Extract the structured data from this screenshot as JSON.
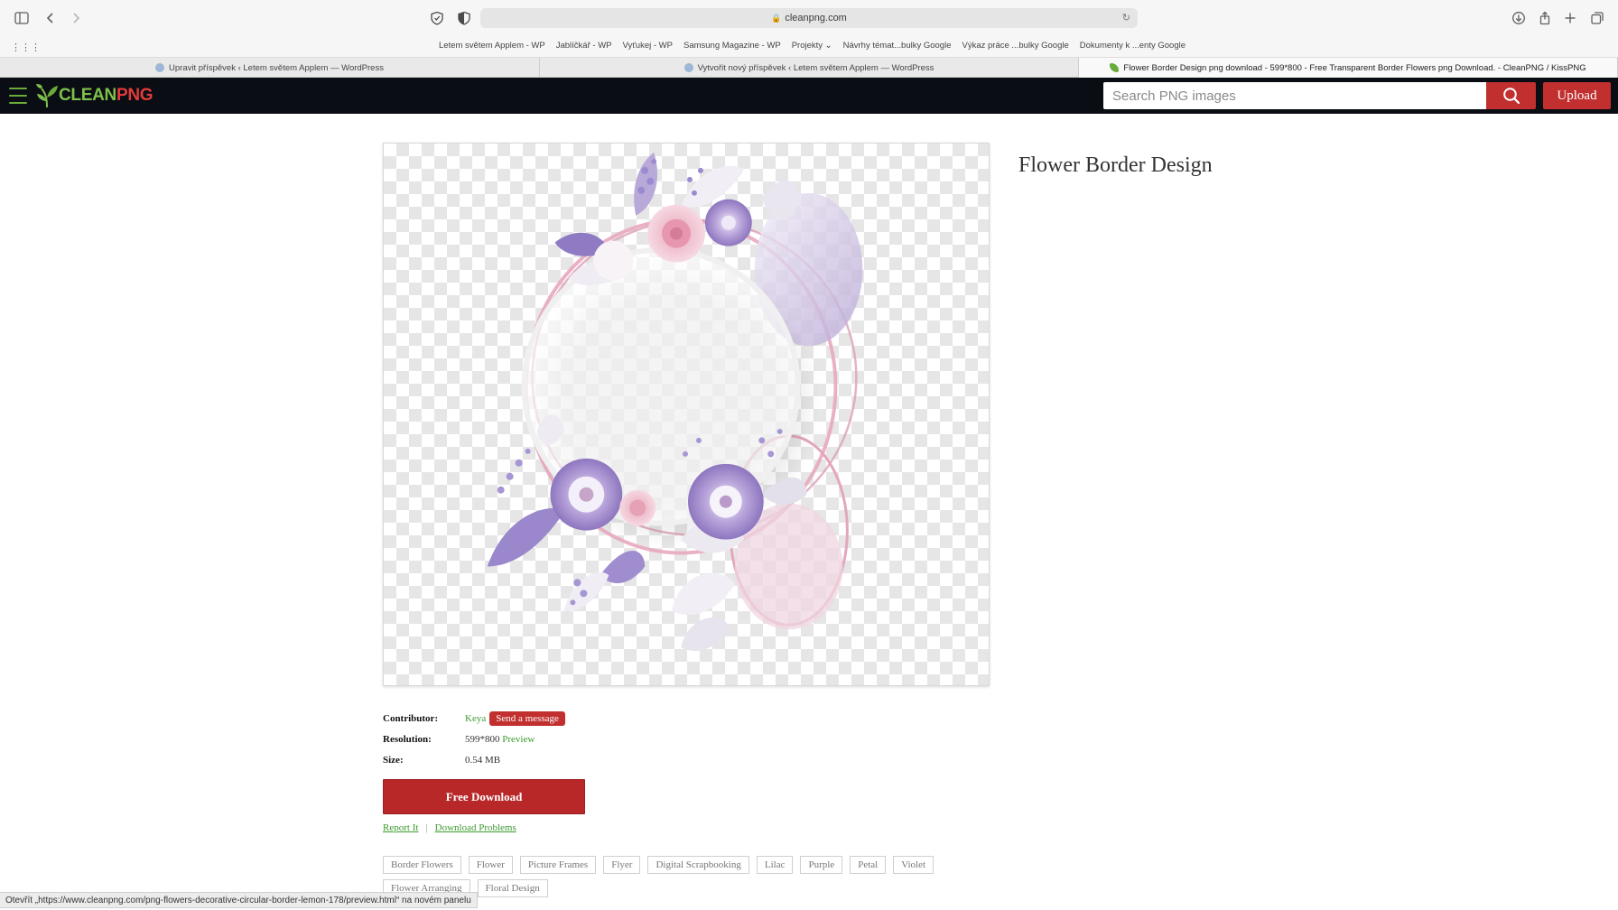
{
  "browser": {
    "url": "cleanpng.com",
    "bookmarks": [
      "Letem světem Applem - WP",
      "Jablíčkář - WP",
      "Vyťukej - WP",
      "Samsung Magazine - WP",
      "Projekty ⌄",
      "Návrhy témat...bulky Google",
      "Výkaz práce ...bulky Google",
      "Dokumenty k ...enty Google"
    ],
    "tabs": [
      {
        "label": "Upravit příspěvek ‹ Letem světem Applem — WordPress",
        "active": false
      },
      {
        "label": "Vytvořit nový příspěvek ‹ Letem světem Applem — WordPress",
        "active": false
      },
      {
        "label": "Flower Border Design png download - 599*800 - Free Transparent Border Flowers png Download. - CleanPNG / KissPNG",
        "active": true
      }
    ],
    "status_text": "Otevřít „https://www.cleanpng.com/png-flowers-decorative-circular-border-lemon-178/preview.html“ na novém panelu"
  },
  "site": {
    "logo_clean": "CLEAN",
    "logo_png": "PNG",
    "search_placeholder": "Search PNG images",
    "upload_label": "Upload"
  },
  "product": {
    "title": "Flower Border Design",
    "contributor_label": "Contributor:",
    "contributor_name": "Keya",
    "send_message": "Send a message",
    "resolution_label": "Resolution:",
    "resolution_value": "599*800",
    "preview_link": "Preview",
    "size_label": "Size:",
    "size_value": "0.54 MB",
    "download_label": "Free Download",
    "report_link": "Report It",
    "separator": "|",
    "problems_link": "Download Problems",
    "tags": [
      "Border Flowers",
      "Flower",
      "Picture Frames",
      "Flyer",
      "Digital Scrapbooking",
      "Lilac",
      "Purple",
      "Petal",
      "Violet",
      "Flower Arranging",
      "Floral Design"
    ]
  },
  "colors": {
    "header_bg": "#0a0d14",
    "accent_red": "#c22f2f",
    "link_green": "#3c9a2e",
    "logo_green": "#7ec14a"
  }
}
